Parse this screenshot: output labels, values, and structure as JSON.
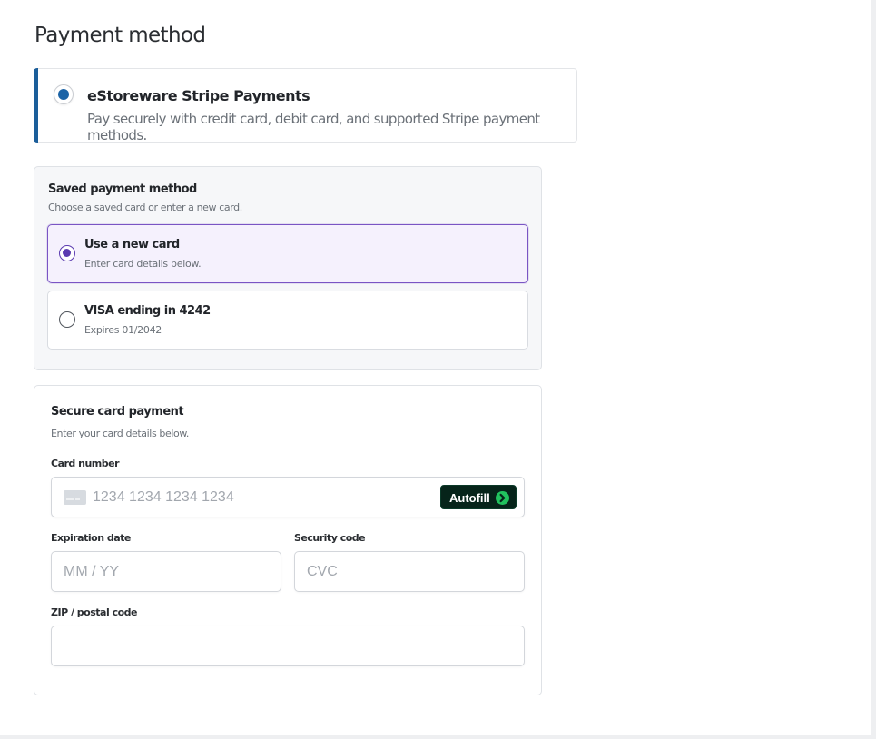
{
  "page": {
    "title": "Payment method"
  },
  "gateway": {
    "name": "eStoreware Stripe Payments",
    "description": "Pay securely with credit card, debit card, and supported Stripe payment methods.",
    "selected": true,
    "accent_color": "#1b5e9a"
  },
  "saved_methods": {
    "title": "Saved payment method",
    "subtitle": "Choose a saved card or enter a new card.",
    "options": [
      {
        "title": "Use a new card",
        "subtitle": "Enter card details below.",
        "selected": true
      },
      {
        "title": "VISA ending in 4242",
        "subtitle": "Expires 01/2042",
        "selected": false
      }
    ],
    "selected_color": "#5b3bb0"
  },
  "card_form": {
    "title": "Secure card payment",
    "subtitle": "Enter your card details below.",
    "card_number": {
      "label": "Card number",
      "placeholder": "1234 1234 1234 1234",
      "value": "",
      "icon": "credit-card-icon"
    },
    "autofill": {
      "label": "Autofill",
      "icon": "arrow-right-circle-icon",
      "color": "#06241a",
      "icon_color": "#21c25e"
    },
    "expiration": {
      "label": "Expiration date",
      "placeholder": "MM / YY",
      "value": ""
    },
    "security_code": {
      "label": "Security code",
      "placeholder": "CVC",
      "value": ""
    },
    "postal_code": {
      "label": "ZIP / postal code",
      "placeholder": "",
      "value": ""
    }
  }
}
